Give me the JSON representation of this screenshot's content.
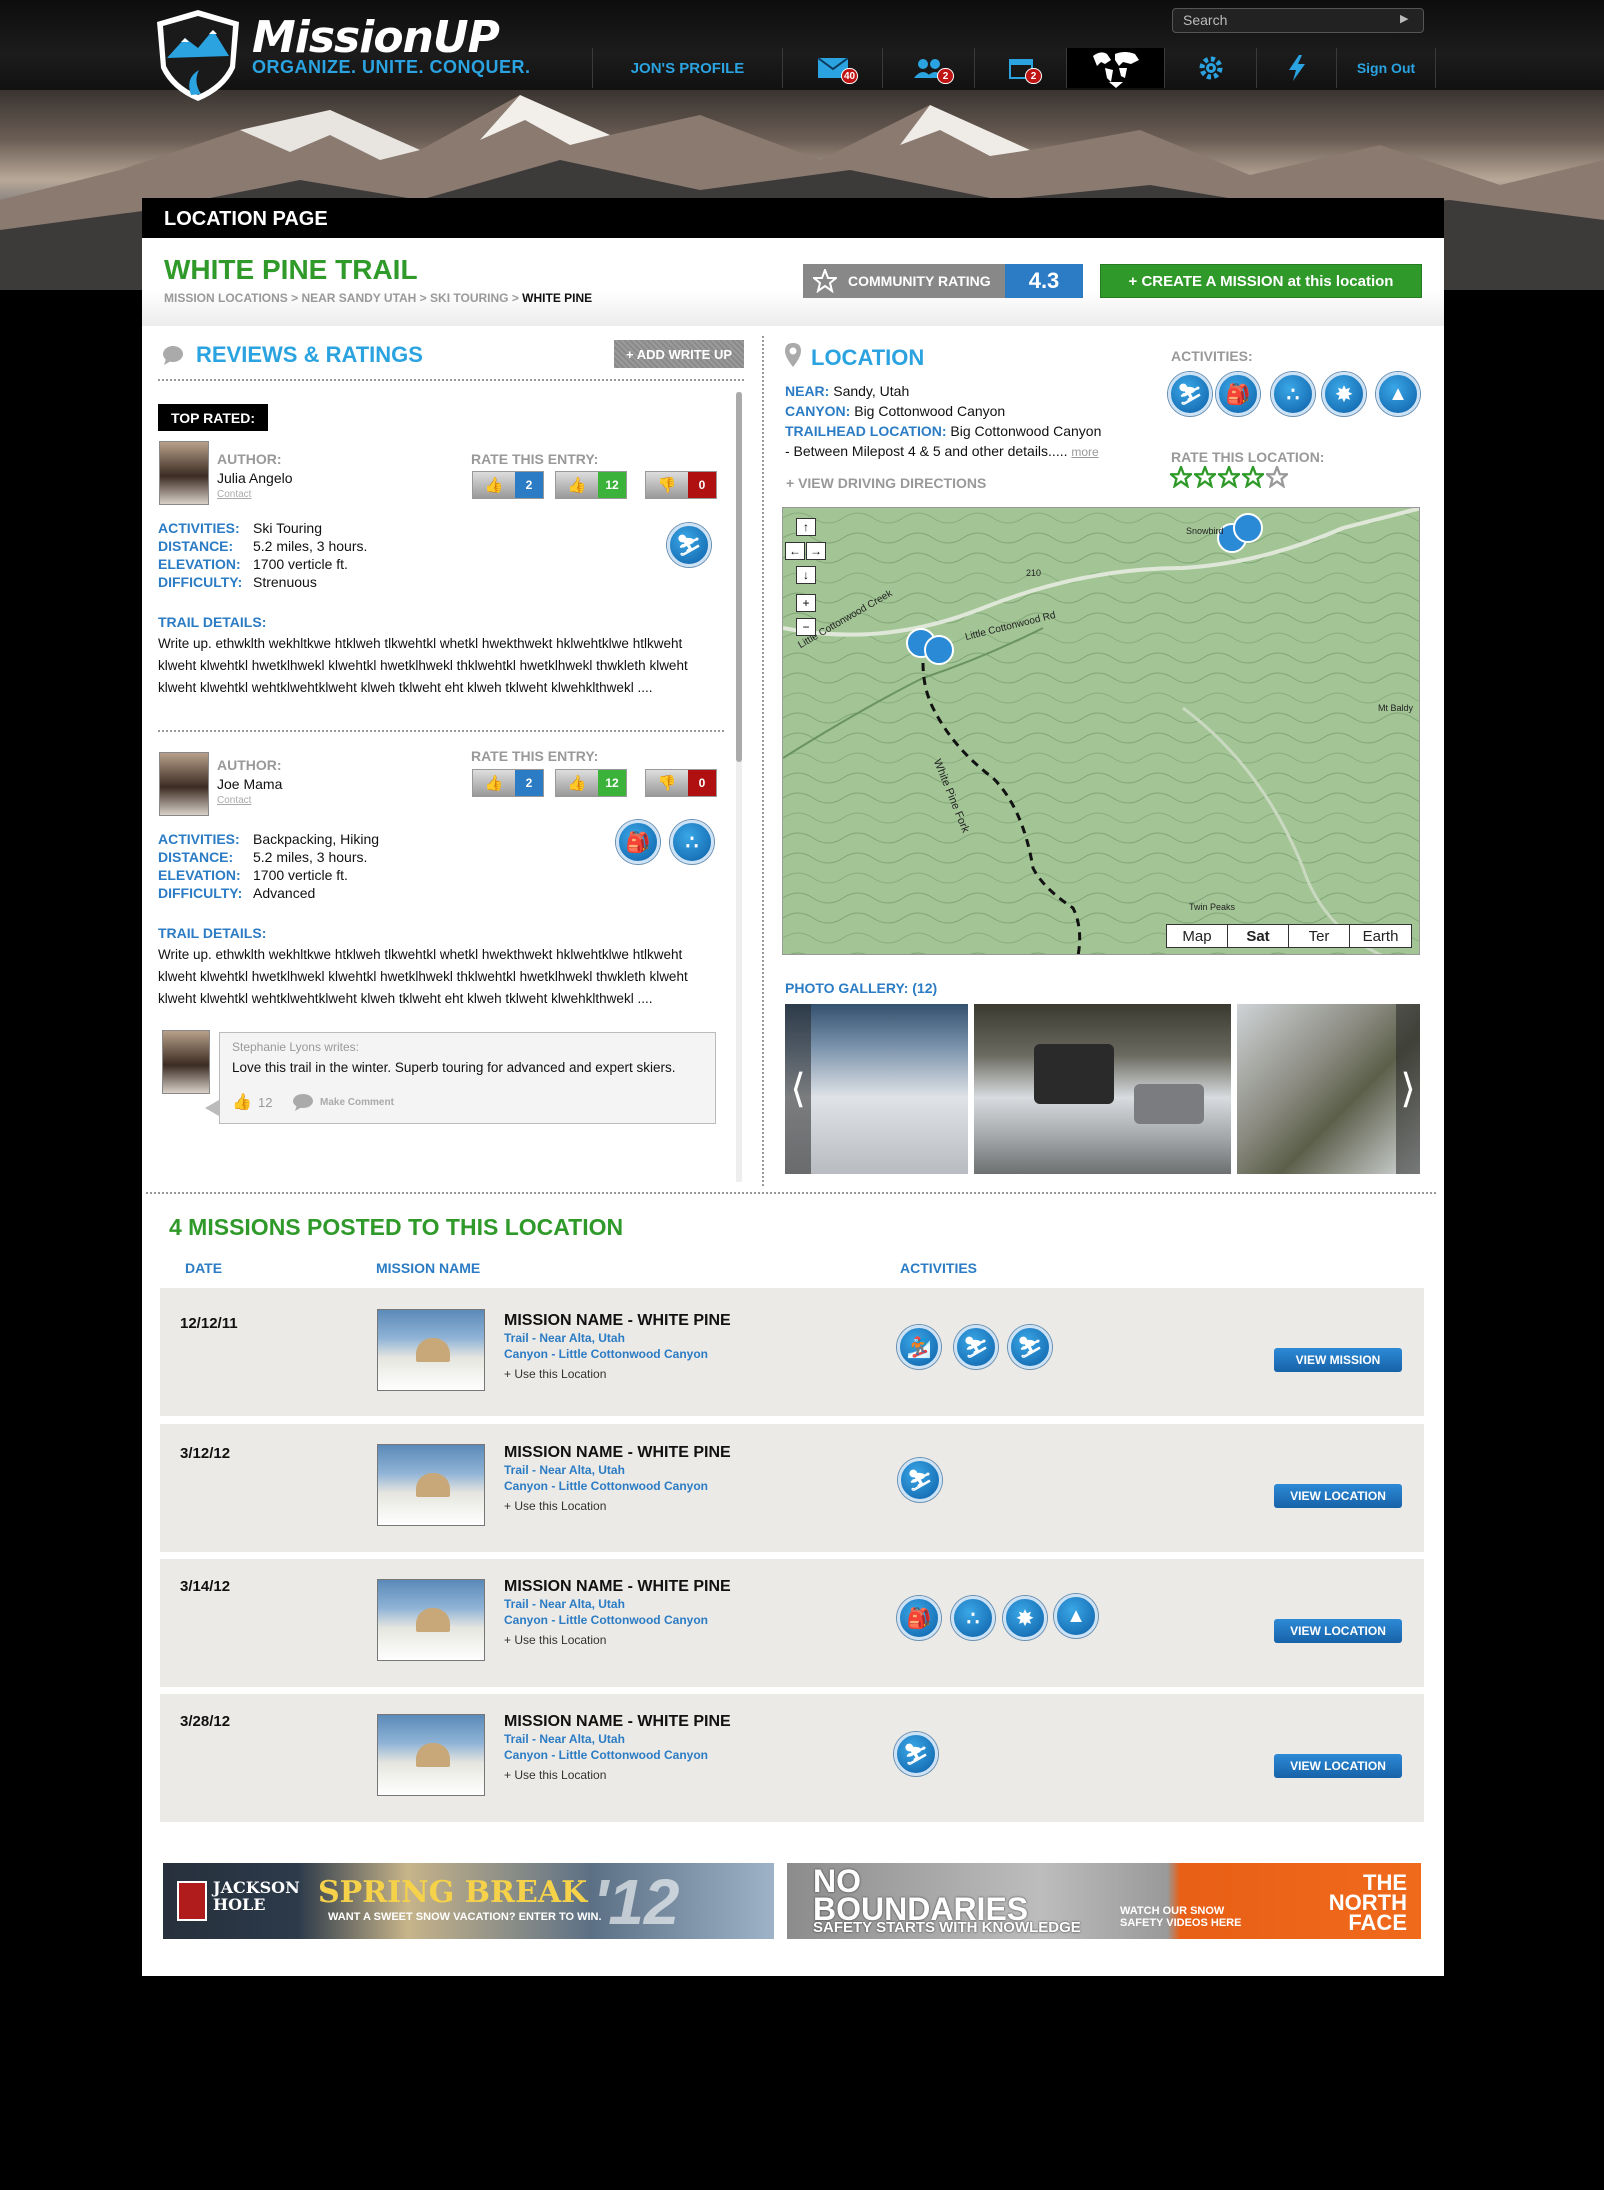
{
  "header": {
    "logo_title": "MissionUP",
    "logo_tagline": "ORGANIZE. UNITE. CONQUER.",
    "search_placeholder": "Search",
    "nav": {
      "profile": "JON'S PROFILE",
      "messages_count": "40",
      "friends_count": "2",
      "calendar_count": "2",
      "sign_out": "Sign Out"
    }
  },
  "page": {
    "bar_title": "LOCATION PAGE",
    "location_title": "WHITE PINE TRAIL",
    "breadcrumb": "MISSION LOCATIONS > NEAR SANDY UTAH > SKI  TOURING > ",
    "breadcrumb_current": "WHITE PINE",
    "community_rating_label": "COMMUNITY RATING",
    "community_rating_value": "4.3",
    "create_mission": "+    CREATE A MISSION at this location"
  },
  "reviews": {
    "heading": "REVIEWS & RATINGS",
    "add_writeup": "+ ADD WRITE UP",
    "top_rated": "TOP RATED:",
    "author_label": "AUTHOR:",
    "contact": "Contact",
    "rate_label": "RATE THIS ENTRY:",
    "activities_label": "ACTIVITIES:",
    "distance_label": "DISTANCE:",
    "elevation_label": "ELEVATION:",
    "difficulty_label": "DIFFICULTY:",
    "trail_details_label": "TRAIL DETAILS:",
    "entries": [
      {
        "author": "Julia Angelo",
        "up": "2",
        "plus": "12",
        "down": "0",
        "activities": "Ski Touring",
        "distance": "5.2 miles, 3 hours.",
        "elevation": "1700 verticle ft.",
        "difficulty": "Strenuous",
        "details": "Write up. ethwklth wekhltkwe htklweh tlkwehtkl whetkl hwekthwekt hklwehtklwe htlkweht klweht klwehtkl hwetklhwekl klwehtkl hwetklhwekl thklwehtkl hwetklhwekl thwkleth klweht klweht klwehtkl wehtklwehtklweht klweh tklweht eht klweh tklweht klwehklthwekl ...."
      },
      {
        "author": "Joe Mama",
        "up": "2",
        "plus": "12",
        "down": "0",
        "activities": "Backpacking, Hiking",
        "distance": "5.2 miles, 3 hours.",
        "elevation": "1700 verticle ft.",
        "difficulty": "Advanced",
        "details": "Write up. ethwklth wekhltkwe htklweh tlkwehtkl whetkl hwekthwekt hklwehtklwe htlkweht klweht klwehtkl hwetklhwekl klwehtkl hwetklhwekl thklwehtkl hwetklhwekl thwkleth klweht klweht klwehtkl wehtklwehtklweht klweh tklweht eht klweh tklweht klwehklthwekl ...."
      }
    ],
    "comment": {
      "writer": "Stephanie Lyons writes:",
      "text": "Love this trail in the winter. Superb touring for advanced and expert skiers.",
      "likes": "12",
      "make_comment": "Make Comment"
    }
  },
  "location": {
    "heading": "LOCATION",
    "near_label": "NEAR:",
    "near": "Sandy, Utah",
    "canyon_label": "CANYON:",
    "canyon": "Big Cottonwood Canyon",
    "trailhead_label": "TRAILHEAD LOCATION:",
    "trailhead": "Big Cottonwood Canyon",
    "trailhead_more": " - Between Milepost 4 & 5 and other details.....",
    "more": "more",
    "driving": "+ VIEW DRIVING DIRECTIONS",
    "activities_label": "ACTIVITIES:",
    "rate_label": "RATE THIS LOCATION:",
    "rating_stars": 4,
    "map_types": [
      "Map",
      "Sat",
      "Ter",
      "Earth"
    ],
    "map_selected": "Sat",
    "map_labels": [
      "Little Cottonwood Creek",
      "Little Cottonwood Rd",
      "White Pine Fork",
      "Mt Baldy",
      "Twin Peaks",
      "Snowbird",
      "210"
    ],
    "gallery_label": "PHOTO GALLERY: (12)"
  },
  "missions": {
    "heading": "4 MISSIONS POSTED TO THIS LOCATION",
    "col_date": "DATE",
    "col_name": "MISSION NAME",
    "col_activities": "ACTIVITIES",
    "use_location": "+ Use this Location",
    "rows": [
      {
        "date": "12/12/11",
        "name": "MISSION NAME - WHITE PINE",
        "trail": "Trail - Near Alta, Utah",
        "canyon": "Canyon - Little Cottonwood Canyon",
        "button": "VIEW MISSION"
      },
      {
        "date": "3/12/12",
        "name": "MISSION NAME - WHITE PINE",
        "trail": "Trail - Near Alta, Utah",
        "canyon": "Canyon - Little Cottonwood Canyon",
        "button": "VIEW LOCATION"
      },
      {
        "date": "3/14/12",
        "name": "MISSION NAME - WHITE PINE",
        "trail": "Trail - Near Alta, Utah",
        "canyon": "Canyon - Little Cottonwood Canyon",
        "button": "VIEW LOCATION"
      },
      {
        "date": "3/28/12",
        "name": "MISSION NAME - WHITE PINE",
        "trail": "Trail - Near Alta, Utah",
        "canyon": "Canyon - Little Cottonwood Canyon",
        "button": "VIEW LOCATION"
      }
    ]
  },
  "ads": {
    "ad1_brand": "JACKSON HOLE",
    "ad1_title": "SPRING BREAK",
    "ad1_sub": "WANT A SWEET SNOW VACATION? ENTER TO WIN.",
    "ad1_year": "'12",
    "ad2_title": "NO BOUNDARIES",
    "ad2_sub": "SAFETY STARTS WITH KNOWLEDGE",
    "ad2_cta": "WATCH OUR SNOW SAFETY VIDEOS HERE",
    "ad2_brand": "THE NORTH FACE"
  },
  "colors": {
    "accent_blue": "#2aa3e0",
    "link_blue": "#2b7cc4",
    "green": "#2f9a2a",
    "red": "#c01414"
  }
}
